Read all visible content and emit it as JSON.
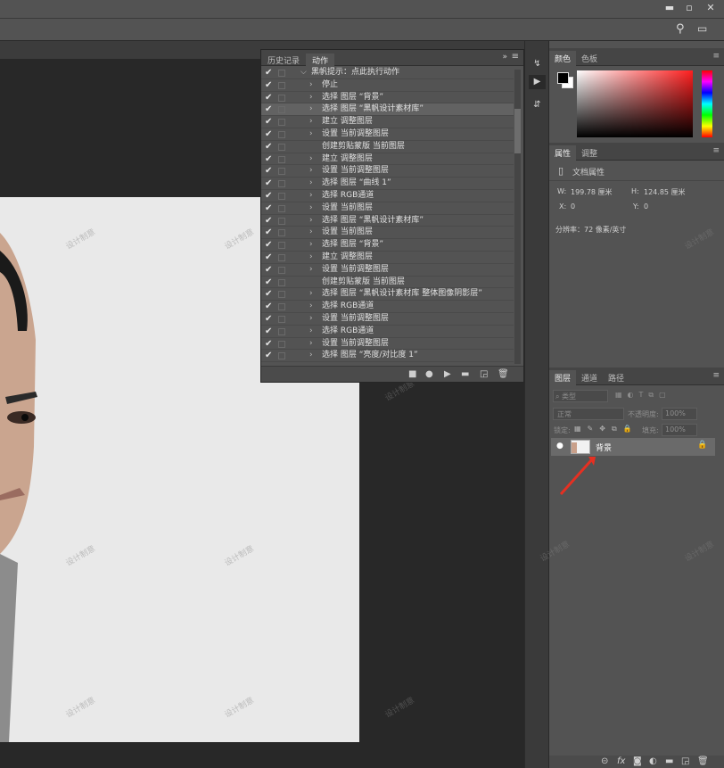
{
  "window": {
    "minimize_icon": "minimize-icon",
    "restore_icon": "restore-icon",
    "close_icon": "close-icon",
    "min_glyph": "▬",
    "restore_glyph": "▫",
    "close_glyph": "✕"
  },
  "options_bar": {
    "search_glyph": "⚲",
    "workspace_glyph": "▭"
  },
  "watermark": "设计制意",
  "actions_panel": {
    "tabs": [
      "历史记录",
      "动作"
    ],
    "active_tab": "动作",
    "expand_glyph": "»",
    "menu_glyph": "≡",
    "set_name": "黑帆提示：点此执行动作",
    "items": [
      "停止",
      "选择 图层 “背景”",
      "选择 图层 “黑帆设计素材库”",
      "建立 调整图层",
      "设置 当前调整图层",
      "创建剪贴蒙版 当前图层",
      "建立 调整图层",
      "设置 当前调整图层",
      "选择 图层 “曲线 1”",
      "选择 RGB通道",
      "设置 当前图层",
      "选择 图层 “黑帆设计素材库”",
      "设置 当前图层",
      "选择 图层 “背景”",
      "建立 调整图层",
      "设置 当前调整图层",
      "创建剪贴蒙版 当前图层",
      "选择 图层 “黑帆设计素材库    整体图像阴影层”",
      "选择 RGB通道",
      "设置 当前调整图层",
      "选择 RGB通道",
      "设置 当前调整图层",
      "选择 图层 “亮度/对比度 1”"
    ],
    "check": "✔",
    "caret_open": "⌵",
    "caret_closed": "›",
    "footer_glyphs": [
      "■",
      "●",
      "▶",
      "▬",
      "◲",
      "🗑"
    ]
  },
  "toolstrip": {
    "glyphs": [
      "↯",
      "▶",
      "⇵"
    ]
  },
  "color_panel": {
    "tabs": [
      "颜色",
      "色板"
    ],
    "active_tab": "颜色",
    "fg_color": "#000000",
    "bg_color": "#ffffff"
  },
  "properties_panel": {
    "tabs": [
      "属性",
      "调整"
    ],
    "active_tab": "属性",
    "doc_icon": "document-icon",
    "doc_glyph": "▯",
    "title": "文档属性",
    "w_label": "W:",
    "w_value": "199.78 厘米",
    "h_label": "H:",
    "h_value": "124.85 厘米",
    "x_label": "X:",
    "x_value": "0",
    "y_label": "Y:",
    "y_value": "0",
    "resolution": "分辨率：72 像素/英寸"
  },
  "layers_panel": {
    "tabs": [
      "图层",
      "通道",
      "路径"
    ],
    "active_tab": "图层",
    "filter_placeholder": "⌕ 类型",
    "blend_mode": "正常",
    "opacity_label": "不透明度:",
    "opacity_value": "100%",
    "lock_label": "锁定:",
    "fill_label": "填充:",
    "fill_value": "100%",
    "eye_glyph": "●",
    "lock_glyph": "🔒",
    "layer_name": "背景",
    "footer_glyphs": [
      "⊝",
      "fx",
      "◙",
      "◐",
      "▬",
      "◲",
      "🗑"
    ]
  }
}
